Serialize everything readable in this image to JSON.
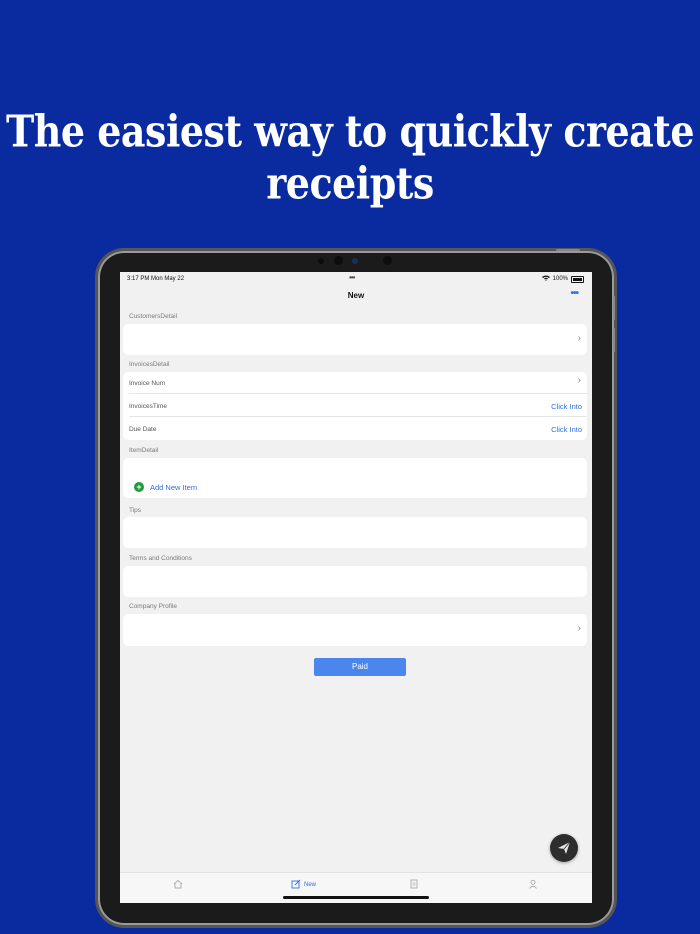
{
  "headline": "The easiest way to quickly create receipts",
  "status_bar": {
    "time": "3:17 PM   Mon May 22",
    "dots": "•••",
    "battery": "100%"
  },
  "nav": {
    "title": "New",
    "more": "•••"
  },
  "sections": {
    "customers": "CustomersDetail",
    "invoices": "InvoicesDetail",
    "items": "ItemDetail",
    "tips": "Tips",
    "terms": "Terms and Conditions",
    "company": "Company Profile"
  },
  "invoice_rows": {
    "invoice_num": "Invoice Num",
    "invoices_time": "InvoicesTime",
    "invoices_time_value": "Click Into",
    "due_date": "Due Date",
    "due_date_value": "Click Into"
  },
  "add_item_label": "Add New Item",
  "paid_button": "Paid",
  "tabs": {
    "new": "New"
  },
  "colors": {
    "background": "#0a2aa0",
    "accent": "#2f6fe0",
    "button": "#4a86ee",
    "add": "#1d9b3b"
  }
}
